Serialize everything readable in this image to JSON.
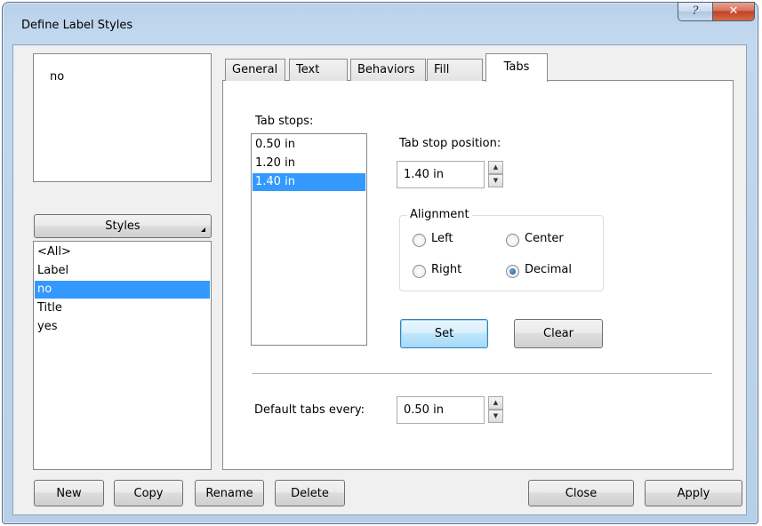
{
  "window": {
    "title": "Define Label Styles",
    "help_glyph": "?",
    "close_glyph": "✕"
  },
  "preview": {
    "text": "no"
  },
  "styles_panel": {
    "button_label": "Styles",
    "items": [
      "<All>",
      "Label",
      "no",
      "Title",
      "yes"
    ],
    "selected_index": 2
  },
  "tabs": {
    "items": [
      "General",
      "Text",
      "Behaviors",
      "Fill",
      "Tabs"
    ],
    "active": "Tabs"
  },
  "tabs_page": {
    "tab_stops_label": "Tab stops:",
    "tab_stops": [
      "0.50 in",
      "1.20 in",
      "1.40 in"
    ],
    "selected_stop_index": 2,
    "position_label": "Tab stop position:",
    "position_value": "1.40 in",
    "alignment": {
      "title": "Alignment",
      "options": [
        "Left",
        "Center",
        "Right",
        "Decimal"
      ],
      "selected": "Decimal"
    },
    "set_label": "Set",
    "clear_label": "Clear",
    "default_label": "Default tabs every:",
    "default_value": "0.50 in"
  },
  "bottom_buttons": {
    "new": "New",
    "copy": "Copy",
    "rename": "Rename",
    "delete": "Delete",
    "close": "Close",
    "apply": "Apply"
  },
  "colors": {
    "selection": "#3399ff",
    "frame": "#b9d1ea",
    "close_button": "#c14226"
  }
}
